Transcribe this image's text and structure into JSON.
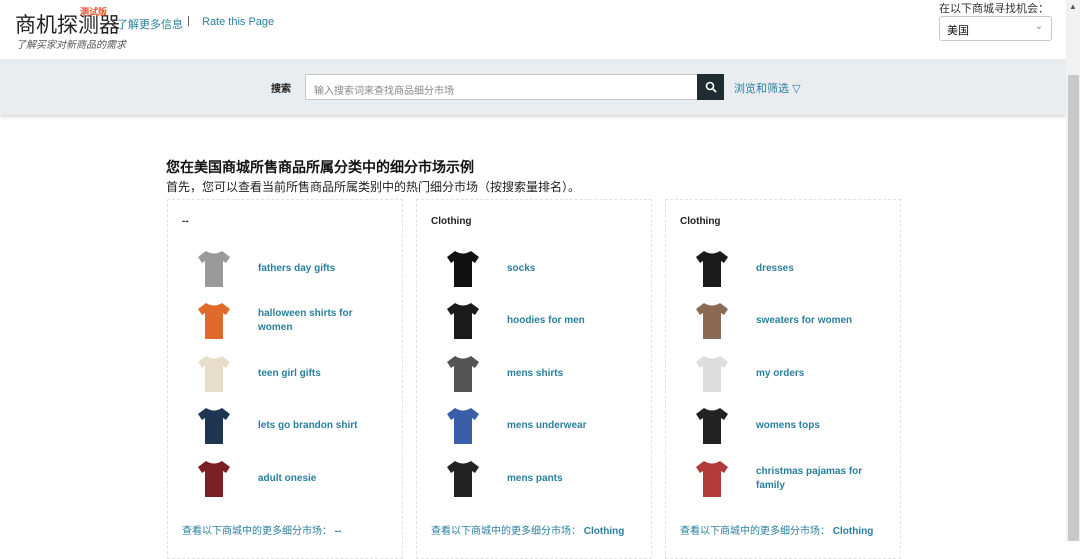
{
  "header": {
    "logo": "商机探测器",
    "beta": "测试版",
    "subtitle": "了解买家对新商品的需求",
    "learn_more": "了解更多信息",
    "separator": "|",
    "rate": "Rate this Page",
    "market_label": "在以下商城寻找机会：",
    "market_value": "美国"
  },
  "search": {
    "label": "搜索",
    "placeholder": "输入搜索词来查找商品细分市场",
    "browse": "浏览和筛选"
  },
  "main": {
    "title": "您在美国商城所售商品所属分类中的细分市场示例",
    "intro": "首先，您可以查看当前所售商品所属类别中的热门细分市场（按搜索量排名）。",
    "cards": [
      {
        "category": "--",
        "more_label": "查看以下商城中的更多细分市场：",
        "more_value": "--",
        "items": [
          {
            "name": "fathers day gifts",
            "icon": "plaid-shirt",
            "color": "#9a9a9a"
          },
          {
            "name": "halloween shirts for women",
            "icon": "orange-tshirt",
            "color": "#e06a2a"
          },
          {
            "name": "teen girl gifts",
            "icon": "dotted-blanket",
            "color": "#e8dccb"
          },
          {
            "name": "lets go brandon shirt",
            "icon": "navy-tshirt",
            "color": "#1f3552"
          },
          {
            "name": "adult onesie",
            "icon": "red-onesie",
            "color": "#7a1f24"
          }
        ]
      },
      {
        "category": "Clothing",
        "more_label": "查看以下商城中的更多细分市场：",
        "more_value": "Clothing",
        "items": [
          {
            "name": "socks",
            "icon": "socks",
            "color": "#111111"
          },
          {
            "name": "hoodies for men",
            "icon": "hoodie",
            "color": "#1a1a1a"
          },
          {
            "name": "mens shirts",
            "icon": "shirts",
            "color": "#555555"
          },
          {
            "name": "mens underwear",
            "icon": "underwear",
            "color": "#3a5fa8"
          },
          {
            "name": "mens pants",
            "icon": "pants",
            "color": "#222222"
          }
        ]
      },
      {
        "category": "Clothing",
        "more_label": "查看以下商城中的更多细分市场：",
        "more_value": "Clothing",
        "items": [
          {
            "name": "dresses",
            "icon": "dress",
            "color": "#1a1a1a"
          },
          {
            "name": "sweaters for women",
            "icon": "sweater",
            "color": "#8a6a55"
          },
          {
            "name": "my orders",
            "icon": "striped-top",
            "color": "#dddddd"
          },
          {
            "name": "womens tops",
            "icon": "black-top",
            "color": "#222222"
          },
          {
            "name": "christmas pajamas for family",
            "icon": "pajamas",
            "color": "#b33a3a"
          }
        ]
      }
    ]
  }
}
